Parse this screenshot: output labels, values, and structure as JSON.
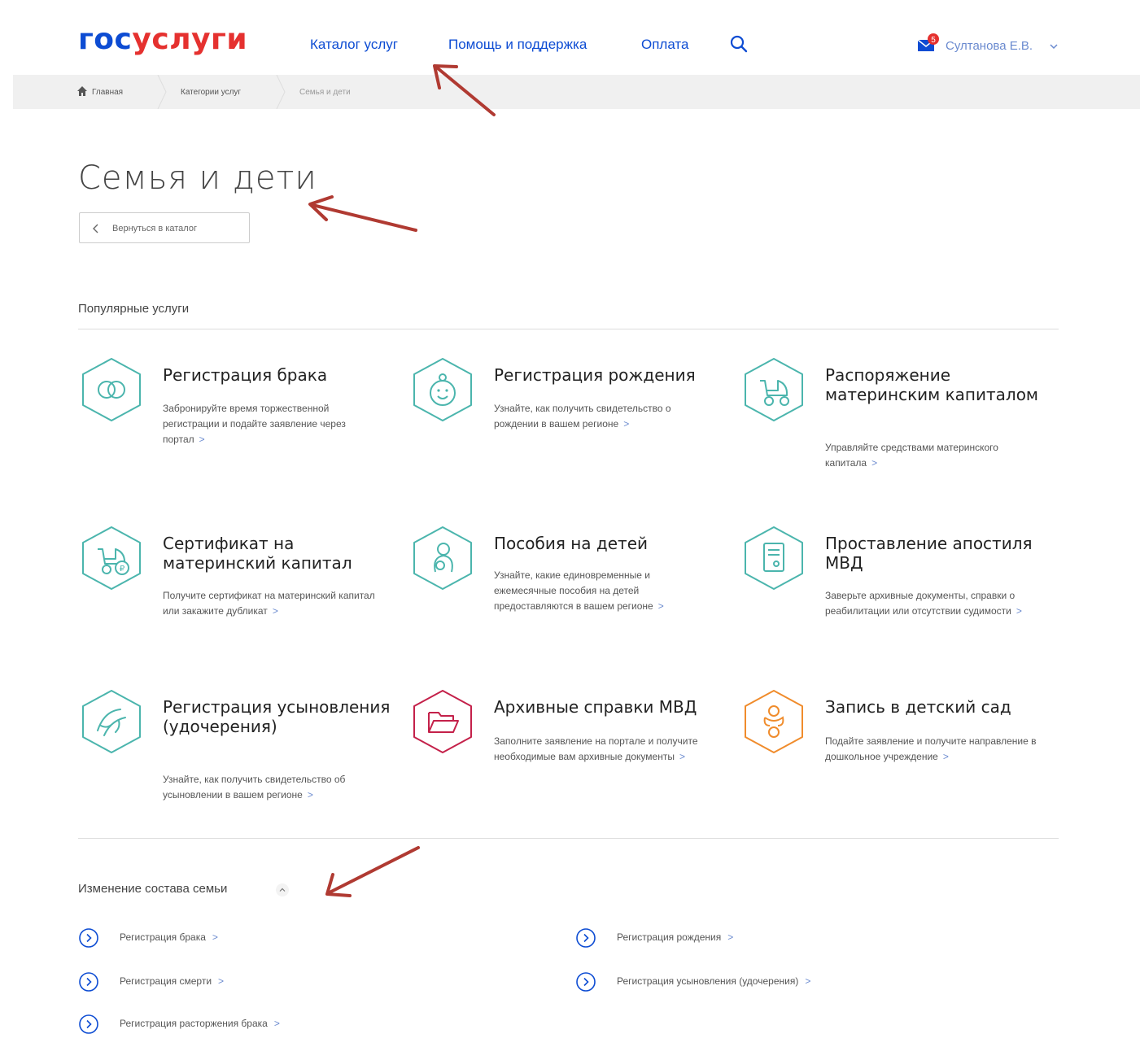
{
  "header": {
    "logo_part1": "гос",
    "logo_part2": "услуги",
    "nav": [
      "Каталог услуг",
      "Помощь и поддержка",
      "Оплата"
    ],
    "search_icon": "search-icon",
    "mail_badge": "5",
    "user_name": "Султанова Е.В."
  },
  "breadcrumbs": [
    "Главная",
    "Категории услуг",
    "Семья и дети"
  ],
  "page": {
    "title": "Семья и дети",
    "back_label": "Вернуться в каталог"
  },
  "popular": {
    "title": "Популярные услуги",
    "cards": [
      {
        "title": "Регистрация брака",
        "desc": "Забронируйте время торжественной регистрации и подайте заявление через портал",
        "icon": "rings-icon",
        "color": "#4bb5ad"
      },
      {
        "title": "Регистрация рождения",
        "desc": "Узнайте, как получить свидетельство о рождении в вашем регионе",
        "icon": "baby-icon",
        "color": "#4bb5ad"
      },
      {
        "title": "Распоряжение материнским капиталом",
        "desc": "Управляйте средствами материнского капитала",
        "icon": "stroller-icon",
        "color": "#4bb5ad"
      },
      {
        "title": "Сертификат на материнский капитал",
        "desc": "Получите сертификат на материнский капитал или закажите дубликат",
        "icon": "stroller-ruble-icon",
        "color": "#4bb5ad"
      },
      {
        "title": "Пособия на детей",
        "desc": "Узнайте, какие единовременные и ежемесячные пособия на детей предоставляются в вашем регионе",
        "icon": "mother-child-icon",
        "color": "#4bb5ad"
      },
      {
        "title": "Проставление апостиля МВД",
        "desc": "Заверьте архивные документы, справки о реабилитации или отсутствии судимости",
        "icon": "document-stamp-icon",
        "color": "#4bb5ad"
      },
      {
        "title": "Регистрация усыновления (удочерения)",
        "desc": "Узнайте, как получить свидетельство об усыновлении в вашем регионе",
        "icon": "hands-icon",
        "color": "#4bb5ad"
      },
      {
        "title": "Архивные справки МВД",
        "desc": "Заполните заявление на портале и получите необходимые вам архивные документы",
        "icon": "folder-icon",
        "color": "#c4214a"
      },
      {
        "title": "Запись в детский сад",
        "desc": "Подайте заявление и получите направление в дошкольное учреждение",
        "icon": "pacifier-icon",
        "color": "#f08c2c"
      }
    ]
  },
  "family": {
    "title": "Изменение состава семьи",
    "links": [
      "Регистрация брака",
      "Регистрация рождения",
      "Регистрация смерти",
      "Регистрация усыновления (удочерения)",
      "Регистрация расторжения брака"
    ]
  },
  "colors": {
    "brand_blue": "#0d4cd3",
    "brand_red": "#e5312f",
    "teal": "#4bb5ad",
    "annotation_arrow": "#b03a32"
  }
}
